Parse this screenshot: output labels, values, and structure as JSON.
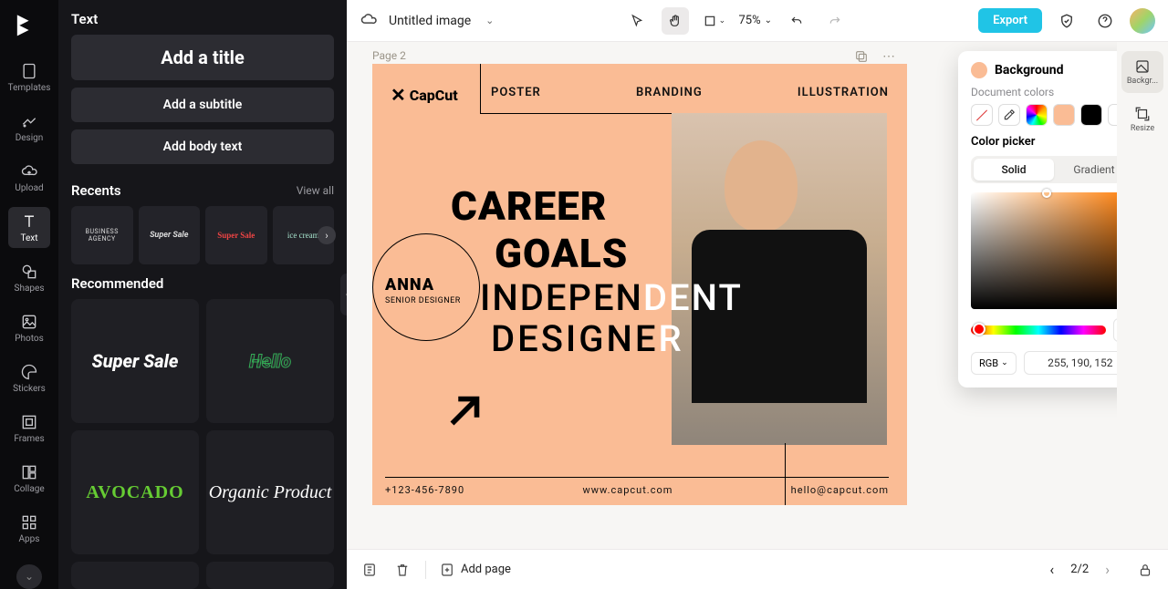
{
  "rail": {
    "items": [
      "Templates",
      "Design",
      "Upload",
      "Text",
      "Shapes",
      "Photos",
      "Stickers",
      "Frames",
      "Collage",
      "Apps"
    ],
    "active": "Text"
  },
  "panel": {
    "title": "Text",
    "buttons": {
      "title": "Add a title",
      "subtitle": "Add a subtitle",
      "body": "Add body text"
    },
    "recents": {
      "heading": "Recents",
      "view_all": "View all",
      "items": [
        "BUSINESS AGENCY",
        "Super Sale",
        "Super Sale",
        "ice cream"
      ]
    },
    "recommended": {
      "heading": "Recommended",
      "items": [
        "Super Sale",
        "Hello",
        "AVOCADO",
        "Organic Product"
      ]
    }
  },
  "topbar": {
    "doc_title": "Untitled image",
    "zoom": "75%",
    "export": "Export"
  },
  "canvas": {
    "page_label": "Page 2",
    "logo": "CapCut",
    "nav": [
      "POSTER",
      "BRANDING",
      "ILLUSTRATION"
    ],
    "anna": {
      "name": "ANNA",
      "role": "SENIOR DESIGNER"
    },
    "headline": {
      "l1": "CAREER",
      "l2": "GOALS"
    },
    "sub1": {
      "a": "INDEPEN",
      "b": "DENT"
    },
    "sub2": {
      "a": "DESIGNE",
      "b": "R"
    },
    "footer": [
      "+123-456-7890",
      "www.capcut.com",
      "hello@capcut.com"
    ]
  },
  "popover": {
    "title": "Background",
    "doc_colors_label": "Document colors",
    "picker_title": "Color picker",
    "tabs": [
      "Solid",
      "Gradient"
    ],
    "active_tab": "Solid",
    "mode": "RGB",
    "value": "255, 190, 152",
    "bg_color": "#fabc95"
  },
  "rrail": {
    "items": [
      "Backgr...",
      "Resize"
    ],
    "active": "Backgr..."
  },
  "bottombar": {
    "add_page": "Add page",
    "page": "2/2"
  }
}
